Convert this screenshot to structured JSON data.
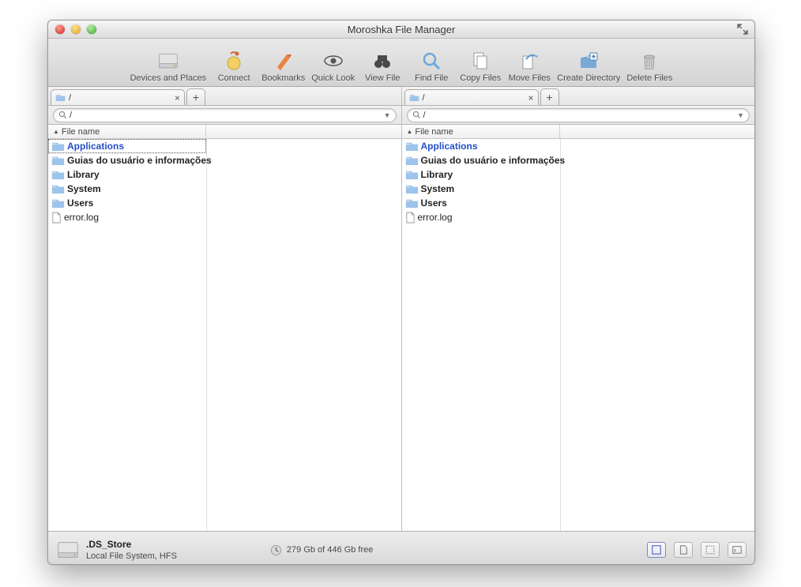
{
  "window": {
    "title": "Moroshka File Manager"
  },
  "toolbar": [
    {
      "id": "devices-and-places",
      "label": "Devices and Places"
    },
    {
      "id": "connect",
      "label": "Connect"
    },
    {
      "id": "bookmarks",
      "label": "Bookmarks"
    },
    {
      "id": "quick-look",
      "label": "Quick Look"
    },
    {
      "id": "view-file",
      "label": "View File"
    },
    {
      "id": "find-file",
      "label": "Find File"
    },
    {
      "id": "copy-files",
      "label": "Copy Files"
    },
    {
      "id": "move-files",
      "label": "Move Files"
    },
    {
      "id": "create-directory",
      "label": "Create Directory"
    },
    {
      "id": "delete-files",
      "label": "Delete Files"
    }
  ],
  "panes": {
    "left": {
      "tab_label": "/",
      "path_value": "/",
      "column_header": "File name",
      "items": [
        {
          "name": "Applications",
          "type": "folder",
          "hot": true,
          "selected": true
        },
        {
          "name": "Guias do usuário e informações",
          "type": "folder"
        },
        {
          "name": "Library",
          "type": "folder"
        },
        {
          "name": "System",
          "type": "folder"
        },
        {
          "name": "Users",
          "type": "folder"
        },
        {
          "name": "error.log",
          "type": "file"
        }
      ]
    },
    "right": {
      "tab_label": "/",
      "path_value": "/",
      "column_header": "File name",
      "items": [
        {
          "name": "Applications",
          "type": "folder",
          "hot": true
        },
        {
          "name": "Guias do usuário e informações",
          "type": "folder"
        },
        {
          "name": "Library",
          "type": "folder"
        },
        {
          "name": "System",
          "type": "folder"
        },
        {
          "name": "Users",
          "type": "folder"
        },
        {
          "name": "error.log",
          "type": "file"
        }
      ]
    }
  },
  "status": {
    "selected_file": ".DS_Store",
    "filesystem": "Local File System, HFS",
    "free_text": "279 Gb of 446 Gb free"
  }
}
